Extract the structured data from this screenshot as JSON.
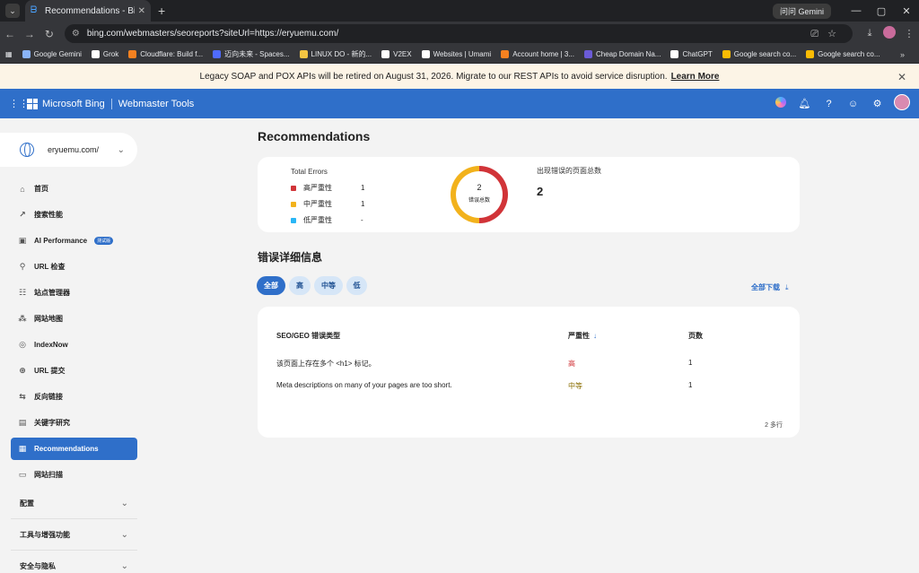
{
  "browser": {
    "tab_title": "Recommendations - Bing We",
    "tab_close": "✕",
    "new_tab": "+",
    "gemini_label": "问问 Gemini",
    "url": "bing.com/webmasters/seoreports?siteUrl=https://eryuemu.com/",
    "window_controls": [
      "—",
      "▢",
      "✕"
    ]
  },
  "bookmarks": [
    {
      "label": "Google Gemini",
      "color": "#8ab4f8"
    },
    {
      "label": "Grok",
      "color": "#ffffff"
    },
    {
      "label": "Cloudflare: Build f...",
      "color": "#f48120"
    },
    {
      "label": "迈向未来 - Spaces...",
      "color": "#4f6bff"
    },
    {
      "label": "LINUX DO - 新的...",
      "color": "#f4c542"
    },
    {
      "label": "V2EX",
      "color": "#ffffff"
    },
    {
      "label": "Websites | Umami",
      "color": "#ffffff"
    },
    {
      "label": "Account home | 3...",
      "color": "#f48120"
    },
    {
      "label": "Cheap Domain Na...",
      "color": "#6b5bd6"
    },
    {
      "label": "ChatGPT",
      "color": "#ffffff"
    },
    {
      "label": "Google search co...",
      "color": "#fbbc04"
    },
    {
      "label": "Google search co...",
      "color": "#fbbc04"
    }
  ],
  "notice": {
    "text": "Legacy SOAP and POX APIs will be retired on August 31, 2026. Migrate to our REST APIs to avoid service disruption.",
    "link": "Learn More"
  },
  "header": {
    "brand": "Microsoft Bing",
    "product": "Webmaster Tools"
  },
  "sidebar": {
    "site": "eryuemu.com/",
    "items": [
      {
        "label": "首页",
        "icon": "home-icon",
        "glyph": "⌂"
      },
      {
        "label": "搜索性能",
        "icon": "trend-icon",
        "glyph": "↗"
      },
      {
        "label": "AI Performance",
        "icon": "ai-icon",
        "glyph": "▣",
        "badge": "测试版"
      },
      {
        "label": "URL 检查",
        "icon": "search-icon",
        "glyph": "⚲"
      },
      {
        "label": "站点管理器",
        "icon": "sitemap-icon",
        "glyph": "☷"
      },
      {
        "label": "网站地图",
        "icon": "tree-icon",
        "glyph": "⁂"
      },
      {
        "label": "IndexNow",
        "icon": "indexnow-icon",
        "glyph": "◎"
      },
      {
        "label": "URL 提交",
        "icon": "globe-icon",
        "glyph": "⊕"
      },
      {
        "label": "反向链接",
        "icon": "link-icon",
        "glyph": "⇆"
      },
      {
        "label": "关键字研究",
        "icon": "doc-icon",
        "glyph": "▤"
      },
      {
        "label": "Recommendations",
        "icon": "recommend-icon",
        "glyph": "▦",
        "active": true
      },
      {
        "label": "网站扫描",
        "icon": "scan-icon",
        "glyph": "▭"
      }
    ],
    "groups": [
      "配置",
      "工具与增强功能",
      "安全与隐私"
    ]
  },
  "main": {
    "title": "Recommendations",
    "summary": {
      "total_errors_label": "Total Errors",
      "severities": [
        {
          "label": "高严重性",
          "count": "1",
          "color": "#d13438"
        },
        {
          "label": "中严重性",
          "count": "1",
          "color": "#f2b21c"
        },
        {
          "label": "低严重性",
          "count": "-",
          "color": "#29b6f6"
        }
      ],
      "donut_total": "2",
      "donut_label": "错误总数",
      "pages_title": "出现错误的页面总数",
      "pages_count": "2"
    },
    "details_title": "错误详细信息",
    "filters": [
      "全部",
      "高",
      "中等",
      "低"
    ],
    "download_all": "全部下载",
    "table": {
      "headers": [
        "SEO/GEO 错误类型",
        "严重性",
        "页数"
      ],
      "rows": [
        {
          "type": "该页面上存在多个 <h1> 标记。",
          "severity": "高",
          "pages": "1"
        },
        {
          "type": "Meta descriptions on many of your pages are too short.",
          "severity": "中等",
          "pages": "1"
        }
      ],
      "row_count": "2 多行"
    }
  }
}
